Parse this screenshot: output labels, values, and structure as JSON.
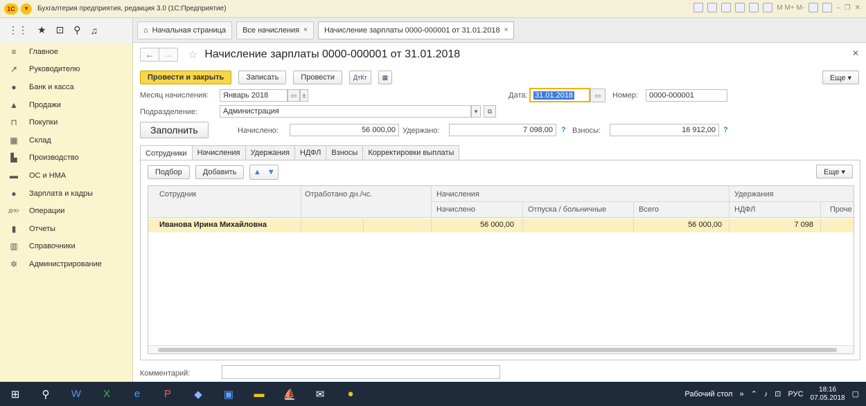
{
  "window": {
    "title": "Бухгалтерия предприятия, редакция 3.0 (1С:Предприятие)",
    "logo_text": "1С",
    "toolbar_text": "M  M+  M-"
  },
  "tabs": [
    {
      "label": "Начальная страница",
      "icon": "home-icon"
    },
    {
      "label": "Все начисления",
      "close": "×"
    },
    {
      "label": "Начисление зарплаты 0000-000001 от 31.01.2018",
      "close": "×"
    }
  ],
  "sidebar": {
    "items": [
      {
        "label": "Главное",
        "icon": "menu-icon",
        "glyph": "≡"
      },
      {
        "label": "Руководителю",
        "icon": "chart-trend-icon",
        "glyph": "↗"
      },
      {
        "label": "Банк и касса",
        "icon": "coin-icon",
        "glyph": "●"
      },
      {
        "label": "Продажи",
        "icon": "shop-icon",
        "glyph": "▲"
      },
      {
        "label": "Покупки",
        "icon": "cart-icon",
        "glyph": "⊓"
      },
      {
        "label": "Склад",
        "icon": "warehouse-icon",
        "glyph": "▦"
      },
      {
        "label": "Производство",
        "icon": "factory-icon",
        "glyph": "▙"
      },
      {
        "label": "ОС и НМА",
        "icon": "truck-icon",
        "glyph": "▬"
      },
      {
        "label": "Зарплата и кадры",
        "icon": "person-icon",
        "glyph": "●"
      },
      {
        "label": "Операции",
        "icon": "debit-credit-icon",
        "glyph": "ДтКт"
      },
      {
        "label": "Отчеты",
        "icon": "bar-chart-icon",
        "glyph": "▮"
      },
      {
        "label": "Справочники",
        "icon": "book-icon",
        "glyph": "▥"
      },
      {
        "label": "Администрирование",
        "icon": "gear-icon",
        "glyph": "✲"
      }
    ]
  },
  "document": {
    "title": "Начисление зарплаты 0000-000001 от 31.01.2018",
    "buttons": {
      "post_close": "Провести и закрыть",
      "save": "Записать",
      "post": "Провести",
      "dtkt": "ДтКт",
      "more": "Еще ▾"
    },
    "month_label": "Месяц начисления:",
    "month_value": "Январь 2018",
    "date_label": "Дата:",
    "date_value": "31.01.2018",
    "number_label": "Номер:",
    "number_value": "0000-000001",
    "department_label": "Подразделение:",
    "department_value": "Администрация",
    "fill_button": "Заполнить",
    "accrued_label": "Начислено:",
    "accrued_value": "56 000,00",
    "withheld_label": "Удержано:",
    "withheld_value": "7 098,00",
    "contrib_label": "Взносы:",
    "contrib_value": "16 912,00",
    "help_mark": "?",
    "comment_label": "Комментарий:"
  },
  "doc_tabs": [
    "Сотрудники",
    "Начисления",
    "Удержания",
    "НДФЛ",
    "Взносы",
    "Корректировки выплаты"
  ],
  "table": {
    "buttons": {
      "pick": "Подбор",
      "add": "Добавить",
      "more": "Еще ▾"
    },
    "headers": {
      "employee": "Сотрудник",
      "worked": "Отработано дн./чс.",
      "accruals_group": "Начисления",
      "accrued": "Начислено",
      "vacation": "Отпуска / больничные",
      "total": "Всего",
      "withholdings_group": "Удержания",
      "ndfl": "НДФЛ",
      "other": "Проче"
    },
    "rows": [
      {
        "employee": "Иванова Ирина Михайловна",
        "accrued": "56 000,00",
        "total": "56 000,00",
        "ndfl": "7 098"
      }
    ]
  },
  "taskbar": {
    "tray_label": "Рабочий стол",
    "lang": "РУС",
    "time": "18:16",
    "date": "07.05.2018"
  },
  "colors": {
    "sidebar_bg": "#fbf5cf",
    "primary_button": "#f7d64a",
    "selected_row": "#fbf1c0",
    "taskbar": "#1f2b3a"
  }
}
